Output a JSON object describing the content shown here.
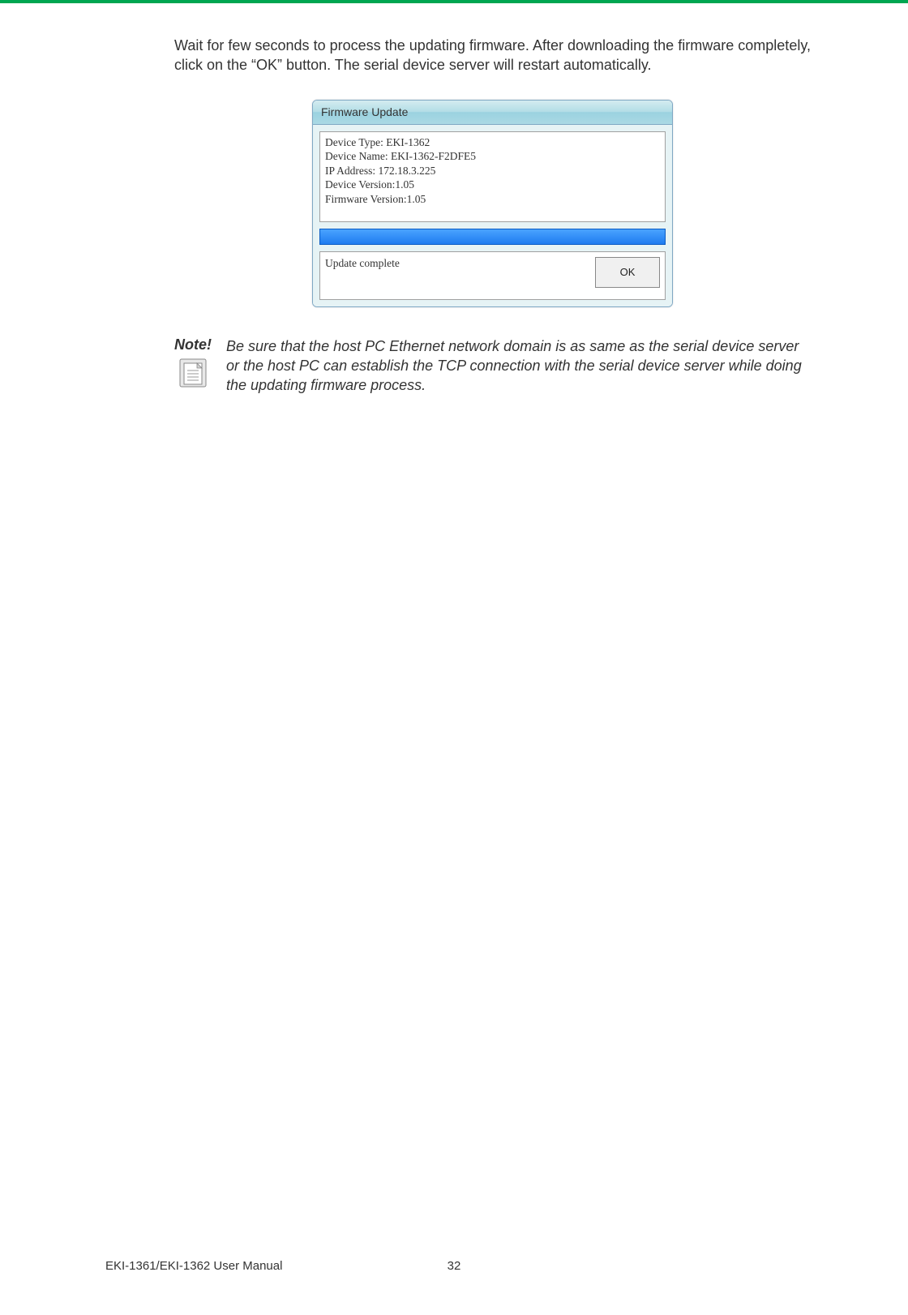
{
  "page": {
    "body_paragraph": "Wait for few seconds to process the updating firmware. After downloading the firmware completely, click on the “OK” button. The serial device server will restart automatically."
  },
  "dialog": {
    "title": "Firmware Update",
    "info": {
      "line1": "Device Type: EKI-1362",
      "line2": "Device Name: EKI-1362-F2DFE5",
      "line3": "IP Address: 172.18.3.225",
      "line4": "Device Version:1.05",
      "line5": "Firmware Version:1.05"
    },
    "status_text": "Update complete",
    "ok_label": "OK"
  },
  "note": {
    "label": "Note!",
    "text": "Be sure that the host PC Ethernet network domain is as same as the serial device server or the host PC can establish the TCP connection with the serial device server while doing the updating firmware process."
  },
  "footer": {
    "manual_title": "EKI-1361/EKI-1362 User Manual",
    "page_number": "32"
  }
}
